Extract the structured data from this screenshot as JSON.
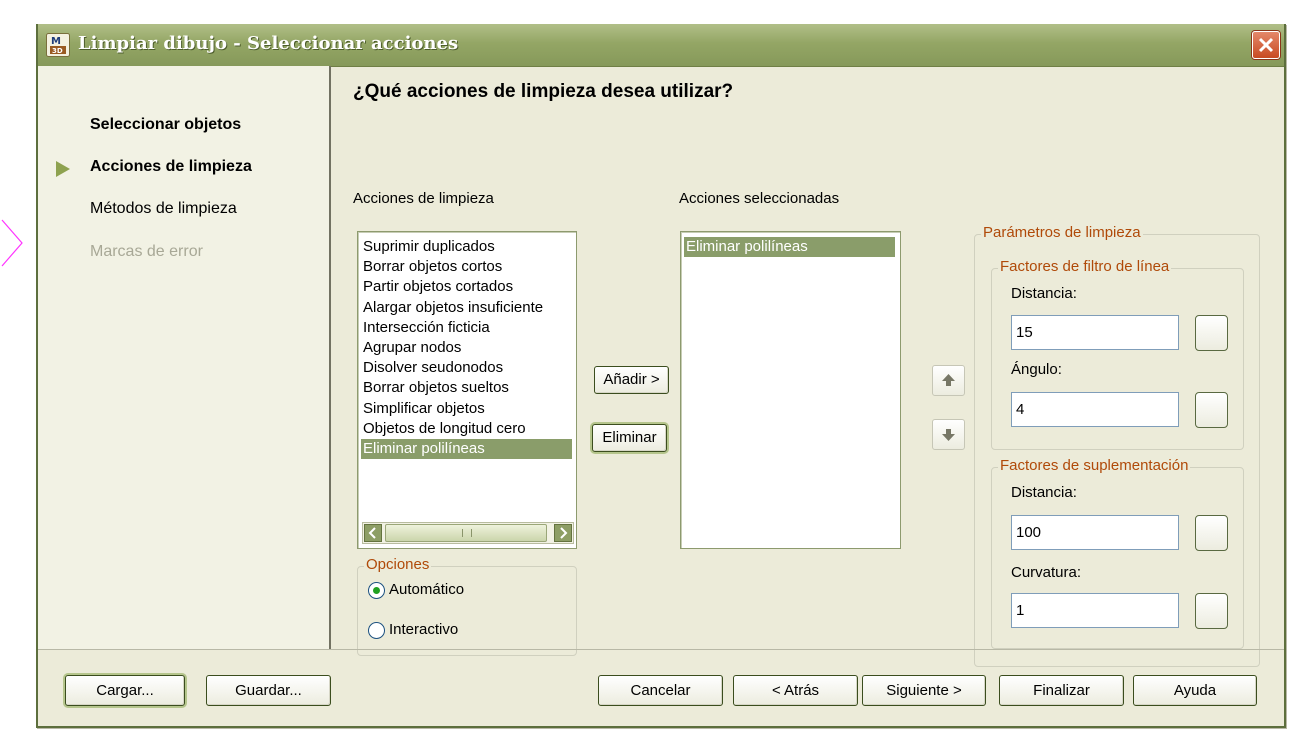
{
  "window": {
    "title": "Limpiar dibujo - Seleccionar acciones"
  },
  "nav": {
    "items": [
      {
        "label": "Seleccionar objetos",
        "state": "bold"
      },
      {
        "label": "Acciones de limpieza",
        "state": "current"
      },
      {
        "label": "Métodos de limpieza",
        "state": "normal"
      },
      {
        "label": "Marcas de error",
        "state": "disabled"
      }
    ]
  },
  "main": {
    "question": "¿Qué acciones de limpieza desea utilizar?",
    "available_label": "Acciones de limpieza",
    "selected_label": "Acciones seleccionadas",
    "available_actions": [
      "Suprimir duplicados",
      "Borrar objetos cortos",
      "Partir objetos cortados",
      "Alargar objetos insuficiente",
      "Intersección ficticia",
      "Agrupar nodos",
      "Disolver seudonodos",
      "Borrar objetos sueltos",
      "Simplificar objetos",
      "Objetos de longitud cero",
      "Eliminar polilíneas"
    ],
    "available_selected_index": 10,
    "selected_actions": [
      "Eliminar polilíneas"
    ],
    "add_button": "Añadir >",
    "remove_button": "Eliminar"
  },
  "options": {
    "title": "Opciones",
    "automatic": "Automático",
    "interactive": "Interactivo",
    "selected": "automatic"
  },
  "params": {
    "title": "Parámetros de limpieza",
    "line_filter": {
      "title": "Factores de filtro de línea",
      "distance_label": "Distancia:",
      "distance_value": "15",
      "angle_label": "Ángulo:",
      "angle_value": "4"
    },
    "supplement": {
      "title": "Factores de suplementación",
      "distance_label": "Distancia:",
      "distance_value": "100",
      "curvature_label": "Curvatura:",
      "curvature_value": "1"
    }
  },
  "footer": {
    "load": "Cargar...",
    "save": "Guardar...",
    "cancel": "Cancelar",
    "back": "< Atrás",
    "next": "Siguiente >",
    "finish": "Finalizar",
    "help": "Ayuda"
  },
  "colors": {
    "title_bar": "#94a665",
    "selection": "#8a9d6a",
    "group_title": "#b04a09",
    "radio_dot": "#20a020",
    "close_button": "#c84a22"
  },
  "icons": {
    "app": "map3d-app-icon",
    "close": "close-icon",
    "current_step": "triangle-right-icon",
    "move_up": "arrow-up-icon",
    "move_down": "arrow-down-icon"
  }
}
